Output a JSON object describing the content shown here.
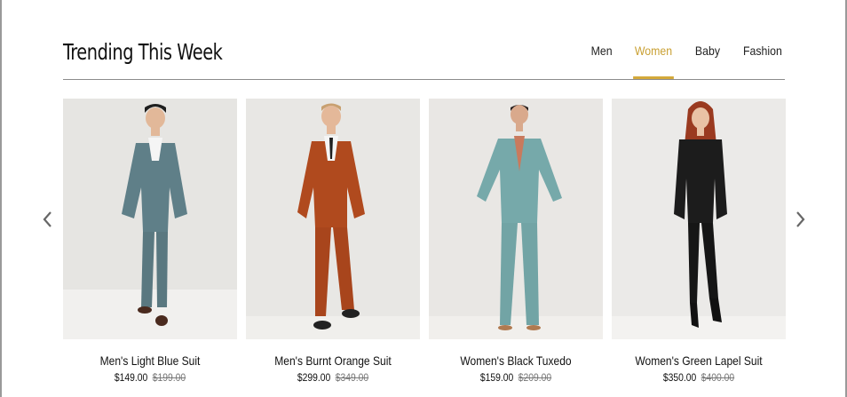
{
  "section": {
    "title": "Trending This Week",
    "tabs": [
      {
        "label": "Men",
        "active": false
      },
      {
        "label": "Women",
        "active": true
      },
      {
        "label": "Baby",
        "active": false
      },
      {
        "label": "Fashion",
        "active": false
      }
    ],
    "accent_color": "#d4a93a"
  },
  "carousel": {
    "prev_icon": "chevron-left-icon",
    "next_icon": "chevron-right-icon"
  },
  "products": [
    {
      "name": "Men's Light Blue Suit",
      "price": "$149.00",
      "old_price": "$199.00",
      "suit_color": "#5f7f88"
    },
    {
      "name": "Men's Burnt Orange Suit",
      "price": "$299.00",
      "old_price": "$349.00",
      "suit_color": "#b04a1e"
    },
    {
      "name": "Women's Black Tuxedo",
      "price": "$159.00",
      "old_price": "$209.00",
      "suit_color": "#76a9aa"
    },
    {
      "name": "Women's Green Lapel Suit",
      "price": "$350.00",
      "old_price": "$400.00",
      "suit_color": "#1c1c1c"
    }
  ]
}
